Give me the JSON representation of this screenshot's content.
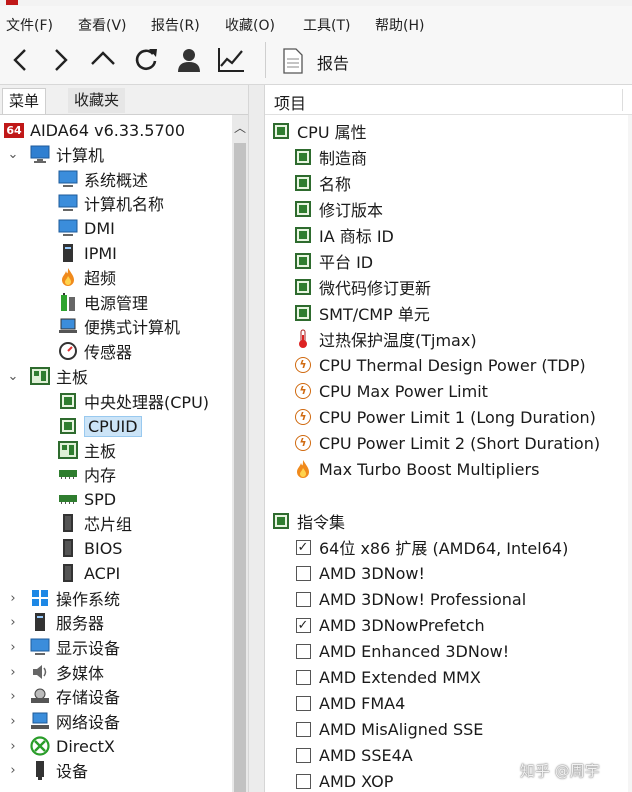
{
  "menubar": {
    "items": [
      "文件(F)",
      "查看(V)",
      "报告(R)",
      "收藏(O)",
      "工具(T)",
      "帮助(H)"
    ]
  },
  "toolbar": {
    "buttons": [
      "back-icon",
      "forward-icon",
      "up-icon",
      "refresh-icon",
      "user-icon",
      "chart-icon"
    ],
    "report_label": "报告"
  },
  "left_panel": {
    "tabs": [
      "菜单",
      "收藏夹"
    ],
    "tree": [
      {
        "label": "AIDA64 v6.33.5700",
        "icon": "aida64-logo",
        "badge": "64"
      },
      {
        "label": "计算机",
        "icon": "computer-icon",
        "expanded": true
      },
      {
        "label": "系统概述",
        "icon": "monitor-icon"
      },
      {
        "label": "计算机名称",
        "icon": "monitor-icon"
      },
      {
        "label": "DMI",
        "icon": "monitor-icon"
      },
      {
        "label": "IPMI",
        "icon": "server-icon"
      },
      {
        "label": "超频",
        "icon": "flame-icon"
      },
      {
        "label": "电源管理",
        "icon": "battery-icon"
      },
      {
        "label": "便携式计算机",
        "icon": "laptop-icon"
      },
      {
        "label": "传感器",
        "icon": "gauge-icon"
      },
      {
        "label": "主板",
        "icon": "motherboard-icon",
        "expanded": true
      },
      {
        "label": "中央处理器(CPU)",
        "icon": "cpu-icon"
      },
      {
        "label": "CPUID",
        "icon": "cpu-icon",
        "selected": true
      },
      {
        "label": "主板",
        "icon": "motherboard-icon"
      },
      {
        "label": "内存",
        "icon": "ram-icon"
      },
      {
        "label": "SPD",
        "icon": "ram-icon"
      },
      {
        "label": "芯片组",
        "icon": "chip-icon"
      },
      {
        "label": "BIOS",
        "icon": "chip-icon"
      },
      {
        "label": "ACPI",
        "icon": "chip-icon"
      },
      {
        "label": "操作系统",
        "icon": "windows-icon"
      },
      {
        "label": "服务器",
        "icon": "server-icon"
      },
      {
        "label": "显示设备",
        "icon": "display-icon"
      },
      {
        "label": "多媒体",
        "icon": "speaker-icon"
      },
      {
        "label": "存储设备",
        "icon": "disk-icon"
      },
      {
        "label": "网络设备",
        "icon": "network-icon"
      },
      {
        "label": "DirectX",
        "icon": "xbox-icon"
      },
      {
        "label": "设备",
        "icon": "device-icon"
      }
    ]
  },
  "right_panel": {
    "column_header": "项目",
    "rows": [
      {
        "label": "CPU 属性",
        "icon": "green-square"
      },
      {
        "label": "制造商",
        "icon": "green-square"
      },
      {
        "label": "名称",
        "icon": "green-square"
      },
      {
        "label": "修订版本",
        "icon": "green-square"
      },
      {
        "label": "IA 商标 ID",
        "icon": "green-square"
      },
      {
        "label": "平台 ID",
        "icon": "green-square"
      },
      {
        "label": "微代码修订更新",
        "icon": "green-square"
      },
      {
        "label": "SMT/CMP 单元",
        "icon": "green-square"
      },
      {
        "label": "过热保护温度(Tjmax)",
        "icon": "thermometer-icon"
      },
      {
        "label": "CPU Thermal Design Power (TDP)",
        "icon": "power-icon"
      },
      {
        "label": "CPU Max Power Limit",
        "icon": "power-icon"
      },
      {
        "label": "CPU Power Limit 1 (Long Duration)",
        "icon": "power-icon"
      },
      {
        "label": "CPU Power Limit 2 (Short Duration)",
        "icon": "power-icon"
      },
      {
        "label": "Max Turbo Boost Multipliers",
        "icon": "flame-icon"
      },
      {
        "label": "指令集",
        "icon": "green-square"
      },
      {
        "label": "64位 x86 扩展 (AMD64, Intel64)",
        "icon": "checkbox",
        "checked": true
      },
      {
        "label": "AMD 3DNow!",
        "icon": "checkbox",
        "checked": false
      },
      {
        "label": "AMD 3DNow! Professional",
        "icon": "checkbox",
        "checked": false
      },
      {
        "label": "AMD 3DNowPrefetch",
        "icon": "checkbox",
        "checked": true
      },
      {
        "label": "AMD Enhanced 3DNow!",
        "icon": "checkbox",
        "checked": false
      },
      {
        "label": "AMD Extended MMX",
        "icon": "checkbox",
        "checked": false
      },
      {
        "label": "AMD FMA4",
        "icon": "checkbox",
        "checked": false
      },
      {
        "label": "AMD MisAligned SSE",
        "icon": "checkbox",
        "checked": false
      },
      {
        "label": "AMD SSE4A",
        "icon": "checkbox",
        "checked": false
      },
      {
        "label": "AMD XOP",
        "icon": "checkbox",
        "checked": false
      }
    ]
  },
  "watermark": "知乎 @周宇",
  "colors": {
    "selection": "#cce4f7",
    "green_icon": "#2f7d2f",
    "aida_red": "#c01818"
  }
}
